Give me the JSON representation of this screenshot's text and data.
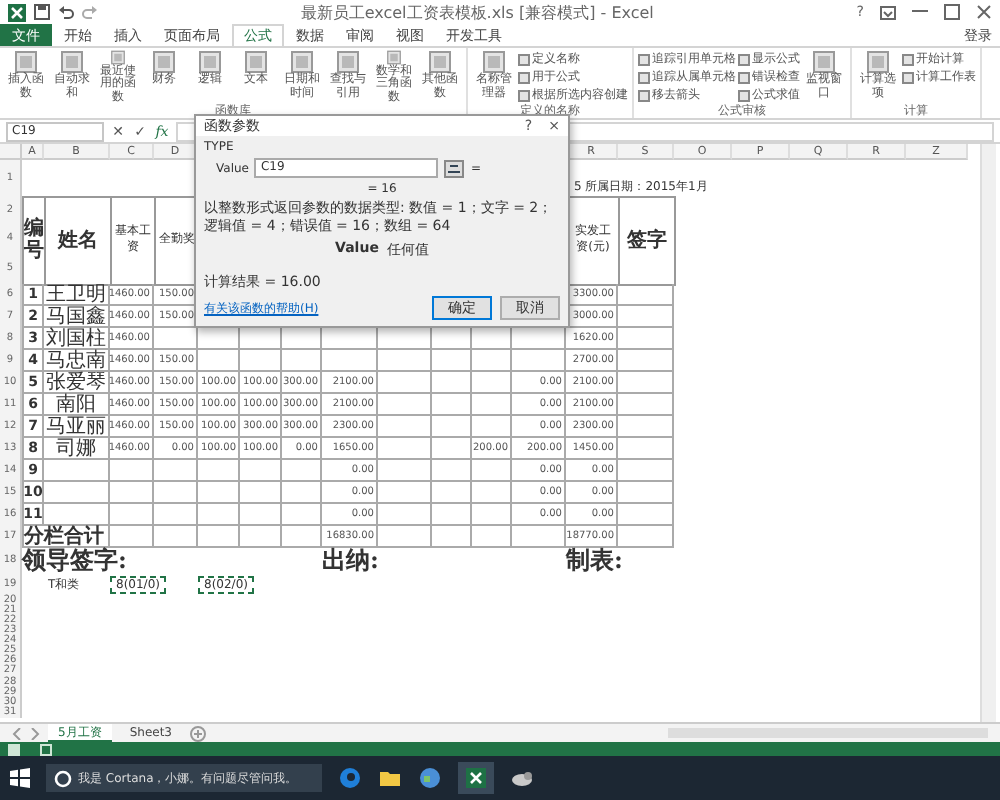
{
  "window": {
    "title": "最新员工excel工资表模板.xls [兼容模式] - Excel",
    "help": "?"
  },
  "ribbon_tabs": [
    {
      "label": "文件",
      "kind": "file",
      "selected": false
    },
    {
      "label": "开始",
      "kind": "tab",
      "selected": false
    },
    {
      "label": "插入",
      "kind": "tab",
      "selected": false
    },
    {
      "label": "页面布局",
      "kind": "tab",
      "selected": false
    },
    {
      "label": "公式",
      "kind": "tab",
      "selected": true
    },
    {
      "label": "数据",
      "kind": "tab",
      "selected": false
    },
    {
      "label": "审阅",
      "kind": "tab",
      "selected": false
    },
    {
      "label": "视图",
      "kind": "tab",
      "selected": false
    },
    {
      "label": "开发工具",
      "kind": "tab",
      "selected": false
    }
  ],
  "account": "登录",
  "ribbon_groups": [
    {
      "label": "函数库",
      "commands": [
        {
          "label": "插入函数",
          "kind": "large"
        },
        {
          "label": "自动求和",
          "kind": "large"
        },
        {
          "label": "最近使用的函数",
          "kind": "large"
        },
        {
          "label": "财务",
          "kind": "large"
        },
        {
          "label": "逻辑",
          "kind": "large"
        },
        {
          "label": "文本",
          "kind": "large"
        },
        {
          "label": "日期和时间",
          "kind": "large"
        },
        {
          "label": "查找与引用",
          "kind": "large"
        },
        {
          "label": "数学和三角函数",
          "kind": "large"
        },
        {
          "label": "其他函数",
          "kind": "large"
        }
      ]
    },
    {
      "label": "定义的名称",
      "commands": [
        {
          "label": "名称管理器",
          "kind": "large"
        },
        {
          "label": "定义名称",
          "kind": "small"
        },
        {
          "label": "用于公式",
          "kind": "small"
        },
        {
          "label": "根据所选内容创建",
          "kind": "small"
        }
      ]
    },
    {
      "label": "公式审核",
      "commands": [
        {
          "label": "追踪引用单元格",
          "kind": "small"
        },
        {
          "label": "追踪从属单元格",
          "kind": "small"
        },
        {
          "label": "移去箭头",
          "kind": "small"
        },
        {
          "label": "显示公式",
          "kind": "small"
        },
        {
          "label": "错误检查",
          "kind": "small"
        },
        {
          "label": "公式求值",
          "kind": "small"
        },
        {
          "label": "监视窗口",
          "kind": "large"
        }
      ]
    },
    {
      "label": "计算",
      "commands": [
        {
          "label": "计算选项",
          "kind": "large"
        },
        {
          "label": "开始计算",
          "kind": "small"
        },
        {
          "label": "计算工作表",
          "kind": "small"
        }
      ]
    }
  ],
  "formula_bar": {
    "name_box": "C19",
    "cancel": "✕",
    "enter": "✓",
    "function": "fx"
  },
  "sheet": {
    "columns_left": [
      "A",
      "B",
      "C",
      "D"
    ],
    "columns_right": [
      "R",
      "S",
      "O",
      "P",
      "Q",
      "R",
      "Z"
    ],
    "rows": [
      {
        "number": "1",
        "kind": "title"
      },
      {
        "number": "2",
        "kind": "header"
      },
      {
        "number": "4",
        "kind": "header"
      },
      {
        "number": "5",
        "kind": "header"
      },
      {
        "number": "6",
        "kind": "data"
      },
      {
        "number": "7",
        "kind": "data"
      },
      {
        "number": "8",
        "kind": "data"
      },
      {
        "number": "9",
        "kind": "data"
      },
      {
        "number": "10",
        "kind": "data"
      },
      {
        "number": "11",
        "kind": "data"
      },
      {
        "number": "12",
        "kind": "data"
      },
      {
        "number": "13",
        "kind": "data"
      },
      {
        "number": "14",
        "kind": "data"
      },
      {
        "number": "15",
        "kind": "data"
      },
      {
        "number": "16",
        "kind": "data"
      },
      {
        "number": "17",
        "kind": "total"
      },
      {
        "number": "18",
        "kind": "sign"
      },
      {
        "number": "19",
        "kind": "note"
      },
      {
        "number": "20",
        "kind": "blank"
      },
      {
        "number": "21",
        "kind": "blank"
      },
      {
        "number": "22",
        "kind": "blank"
      },
      {
        "number": "23",
        "kind": "blank"
      },
      {
        "number": "24",
        "kind": "blank"
      },
      {
        "number": "25",
        "kind": "blank"
      },
      {
        "number": "26",
        "kind": "blank"
      },
      {
        "number": "27",
        "kind": "blank"
      },
      {
        "number": "28",
        "kind": "blank"
      },
      {
        "number": "29",
        "kind": "blank"
      },
      {
        "number": "30",
        "kind": "blank"
      },
      {
        "number": "31",
        "kind": "blank"
      }
    ],
    "date_text": "5 所属日期：2015年1月",
    "header": {
      "number": "编号",
      "name": "姓名",
      "base_pay": "基本工资",
      "attendance": "全勤奖",
      "net_pay": "实发工资(元)",
      "signature": "签字"
    },
    "employees": [
      {
        "no": "1",
        "name": "王卫明",
        "base_pay": "1460.00",
        "attendance": "150.00",
        "net_pay": "3300.00"
      },
      {
        "no": "2",
        "name": "马国鑫",
        "base_pay": "1460.00",
        "attendance": "150.00",
        "net_pay": "3000.00"
      },
      {
        "no": "3",
        "name": "刘国柱",
        "base_pay": "1460.00",
        "net_pay": "1620.00"
      },
      {
        "no": "4",
        "name": "马忠南",
        "base_pay": "1460.00",
        "attendance": "150.00",
        "net_pay": "2700.00"
      },
      {
        "no": "5",
        "name": "张爱琴",
        "base_pay": "1460.00",
        "attendance": "150.00",
        "column_e": "100.00",
        "column_f": "100.00",
        "column_g": "300.00",
        "column_h": "2100.00",
        "column_l": "0.00",
        "net_pay": "2100.00"
      },
      {
        "no": "6",
        "name": "南阳",
        "base_pay": "1460.00",
        "attendance": "150.00",
        "column_e": "100.00",
        "column_f": "100.00",
        "column_g": "300.00",
        "column_h": "2100.00",
        "column_l": "0.00",
        "net_pay": "2100.00"
      },
      {
        "no": "7",
        "name": "马亚丽",
        "base_pay": "1460.00",
        "attendance": "150.00",
        "column_e": "100.00",
        "column_f": "300.00",
        "column_g": "300.00",
        "column_h": "2300.00",
        "column_l": "0.00",
        "net_pay": "2300.00"
      },
      {
        "no": "8",
        "name": "司娜",
        "base_pay": "1460.00",
        "attendance": "0.00",
        "column_e": "100.00",
        "column_f": "100.00",
        "column_g": "0.00",
        "column_h": "1650.00",
        "column_k": "200.00",
        "column_l": "200.00",
        "net_pay": "1450.00"
      },
      {
        "no": "9",
        "column_h": "0.00",
        "column_l": "0.00",
        "net_pay": "0.00"
      },
      {
        "no": "10",
        "column_h": "0.00",
        "column_l": "0.00",
        "net_pay": "0.00"
      },
      {
        "no": "11",
        "column_h": "0.00",
        "column_l": "0.00",
        "net_pay": "0.00"
      }
    ],
    "total": {
      "label": "分栏合计",
      "column_h": "16830.00",
      "net_pay": "18770.00"
    },
    "signatures": [
      "领导签字:",
      "出纳:",
      "制表:"
    ],
    "notes": [
      {
        "text": "T和类",
        "marquee": false
      },
      {
        "text": "8(01/0)",
        "marquee": true
      },
      {
        "text": "8(02/0)",
        "marquee": true
      }
    ]
  },
  "dialog": {
    "title": "函数参数",
    "help": "?",
    "close": "×",
    "function": "TYPE",
    "argument": {
      "label": "Value",
      "value": "C19",
      "equals": "="
    },
    "argument_result": "= 16",
    "description": "以整数形式返回参数的数据类型: 数值 = 1；文字 = 2；逻辑值 = 4；错误值 = 16；数组 = 64",
    "argument_help": {
      "name": "Value",
      "text": "任何值"
    },
    "result": "计算结果 =  16.00",
    "help_link": "有关该函数的帮助(H)",
    "buttons": [
      {
        "label": "确定",
        "default": true
      },
      {
        "label": "取消",
        "default": false
      }
    ]
  },
  "sheet_tabs": [
    {
      "label": "5月工资",
      "selected": true
    },
    {
      "label": "Sheet3",
      "selected": false
    }
  ],
  "taskbar": {
    "search": "我是 Cortana，小娜。有问题尽管问我。"
  }
}
